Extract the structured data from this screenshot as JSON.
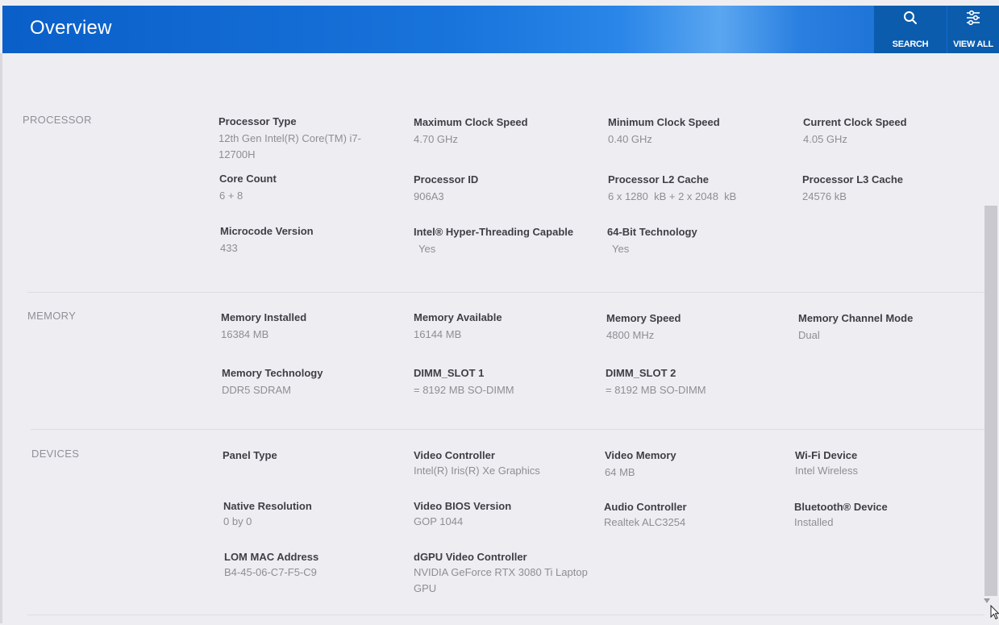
{
  "header": {
    "title": "Overview",
    "search_label": "SEARCH",
    "viewall_label": "VIEW ALL",
    "search_icon": "search-icon",
    "viewall_icon": "filter-list-icon",
    "bg_color": "#1570d8",
    "button_bg_color": "#0b5cad"
  },
  "processor": {
    "label": "PROCESSOR",
    "fields": [
      {
        "name": "Processor Type",
        "value": "12th Gen Intel(R) Core(TM) i7-12700H"
      },
      {
        "name": "Maximum Clock Speed",
        "value": "4.70 GHz"
      },
      {
        "name": "Minimum Clock Speed",
        "value": "0.40 GHz"
      },
      {
        "name": "Current Clock Speed",
        "value": "4.05 GHz"
      },
      {
        "name": "Core Count",
        "value": "6 + 8"
      },
      {
        "name": "Processor ID",
        "value": "906A3"
      },
      {
        "name": "Processor L2 Cache",
        "value": "6 x 1280  kB + 2 x 2048  kB"
      },
      {
        "name": "Processor L3 Cache",
        "value": "24576 kB"
      },
      {
        "name": "Microcode Version",
        "value": "433"
      },
      {
        "name": "Intel® Hyper-Threading Capable",
        "value": "Yes"
      },
      {
        "name": "64-Bit Technology",
        "value": "Yes"
      }
    ]
  },
  "memory": {
    "label": "MEMORY",
    "fields": [
      {
        "name": "Memory Installed",
        "value": "16384 MB"
      },
      {
        "name": "Memory Available",
        "value": "16144 MB"
      },
      {
        "name": "Memory Speed",
        "value": "4800 MHz"
      },
      {
        "name": "Memory Channel Mode",
        "value": "Dual"
      },
      {
        "name": "Memory Technology",
        "value": "DDR5 SDRAM"
      },
      {
        "name": "DIMM_SLOT 1",
        "value": "= 8192 MB SO-DIMM"
      },
      {
        "name": "DIMM_SLOT 2",
        "value": "= 8192 MB SO-DIMM"
      }
    ]
  },
  "devices": {
    "label": "DEVICES",
    "fields": [
      {
        "name": "Panel Type",
        "value": ""
      },
      {
        "name": "Video Controller",
        "value": "Intel(R) Iris(R) Xe Graphics"
      },
      {
        "name": "Video Memory",
        "value": "64 MB"
      },
      {
        "name": "Wi-Fi Device",
        "value": "Intel Wireless"
      },
      {
        "name": "Native Resolution",
        "value": "0 by 0"
      },
      {
        "name": "Video BIOS Version",
        "value": "GOP 1044"
      },
      {
        "name": "Audio Controller",
        "value": "Realtek ALC3254"
      },
      {
        "name": "Bluetooth® Device",
        "value": "Installed"
      },
      {
        "name": "LOM MAC Address",
        "value": "B4-45-06-C7-F5-C9"
      },
      {
        "name": "dGPU Video Controller",
        "value": "NVIDIA GeForce RTX 3080 Ti Laptop GPU"
      }
    ]
  }
}
